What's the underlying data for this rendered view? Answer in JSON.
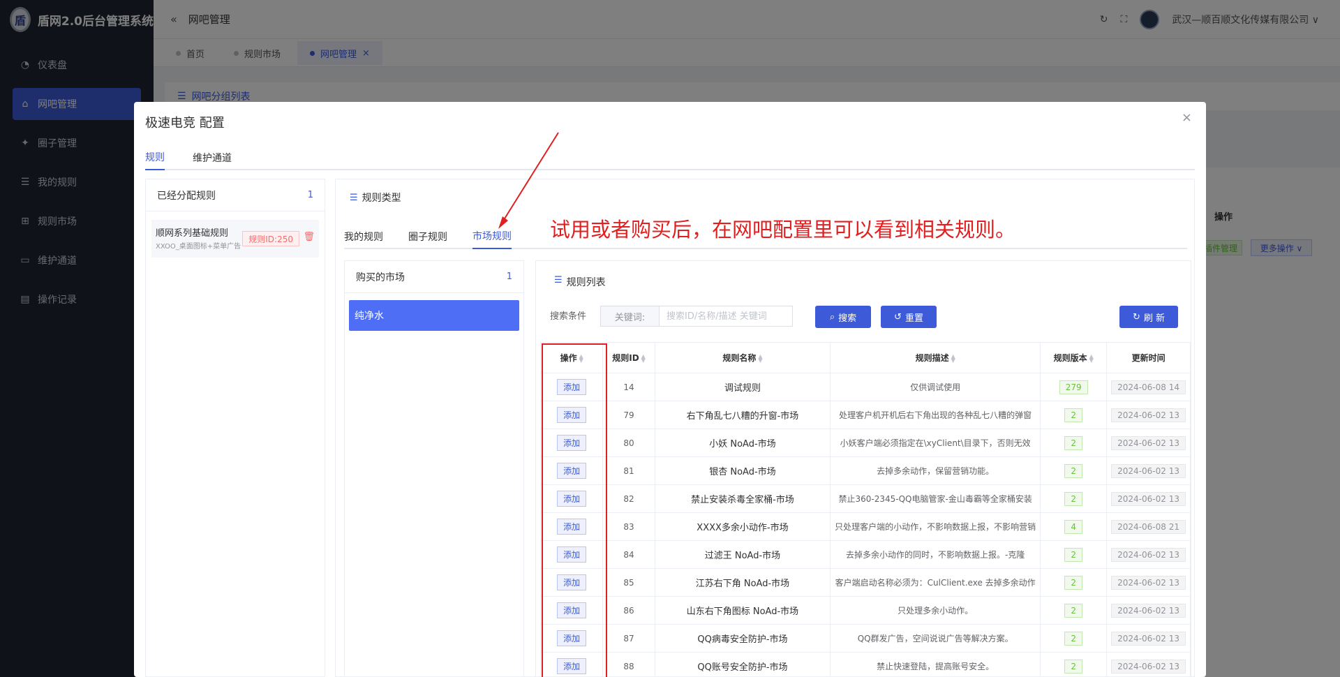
{
  "app": {
    "title": "盾网2.0后台管理系统",
    "logo_text": "盾"
  },
  "sidebar": {
    "items": [
      {
        "label": "仪表盘",
        "icon": "dashboard-icon"
      },
      {
        "label": "网吧管理",
        "icon": "home-icon"
      },
      {
        "label": "圈子管理",
        "icon": "circle-icon"
      },
      {
        "label": "我的规则",
        "icon": "list-icon"
      },
      {
        "label": "规则市场",
        "icon": "gift-icon"
      },
      {
        "label": "维护通道",
        "icon": "monitor-icon"
      },
      {
        "label": "操作记录",
        "icon": "document-icon"
      }
    ],
    "active_index": 1
  },
  "header": {
    "breadcrumb": "网吧管理",
    "user": "武汉—顺百顺文化传媒有限公司"
  },
  "tags": [
    {
      "label": "首页"
    },
    {
      "label": "规则市场"
    },
    {
      "label": "网吧管理",
      "close": "×"
    }
  ],
  "background": {
    "group_list": "网吧分组列表",
    "op_header": "操作",
    "op_btn1": "插件管理",
    "op_btn2": "更多操作 ∨"
  },
  "dialog": {
    "title": "极速电竞 配置",
    "close": "×",
    "tabs": [
      "规则",
      "维护通道"
    ],
    "assigned": {
      "title": "已经分配规则",
      "count": "1",
      "rule": {
        "name": "顺网系列基础规则",
        "sub": "XXOO_桌面图标+菜单广告",
        "tag": "规则ID:250"
      }
    },
    "rule_type": "规则类型",
    "sub_tabs": [
      "我的规则",
      "圈子规则",
      "市场规则"
    ],
    "annotation": "试用或者购买后，在网吧配置里可以看到相关规则。",
    "market": {
      "title": "购买的市场",
      "count": "1",
      "item": "纯净水"
    },
    "list": {
      "title": "规则列表",
      "search_label": "搜索条件",
      "search_prefix": "关键词:",
      "search_placeholder": "搜索ID/名称/描述 关键词",
      "search_btn": "搜索",
      "reset_btn": "重置",
      "refresh_btn": "刷 新",
      "columns": [
        "操作",
        "规则ID",
        "规则名称",
        "规则描述",
        "规则版本",
        "更新时间"
      ],
      "add_label": "添加",
      "rows": [
        {
          "id": "14",
          "name": "调试规则",
          "desc": "仅供调试使用",
          "ver": "279",
          "time": "2024-06-08 14"
        },
        {
          "id": "79",
          "name": "右下角乱七八糟的升窗-市场",
          "desc": "处理客户机开机后右下角出现的各种乱七八糟的弹窗",
          "ver": "2",
          "time": "2024-06-02 13"
        },
        {
          "id": "80",
          "name": "小妖 NoAd-市场",
          "desc": "小妖客户端必须指定在\\xyClient\\目录下，否则无效",
          "ver": "2",
          "time": "2024-06-02 13"
        },
        {
          "id": "81",
          "name": "银杏 NoAd-市场",
          "desc": "去掉多余动作，保留营销功能。",
          "ver": "2",
          "time": "2024-06-02 13"
        },
        {
          "id": "82",
          "name": "禁止安装杀毒全家桶-市场",
          "desc": "禁止360-2345-QQ电脑管家-金山毒霸等全家桶安装",
          "ver": "2",
          "time": "2024-06-02 13"
        },
        {
          "id": "83",
          "name": "XXXX多余小动作-市场",
          "desc": "只处理客户端的小动作，不影响数据上报，不影响营销",
          "ver": "4",
          "time": "2024-06-08 21"
        },
        {
          "id": "84",
          "name": "过滤王 NoAd-市场",
          "desc": "去掉多余小动作的同时，不影响数据上报。-克隆",
          "ver": "2",
          "time": "2024-06-02 13"
        },
        {
          "id": "85",
          "name": "江苏右下角 NoAd-市场",
          "desc": "客户端启动名称必须为：CulClient.exe 去掉多余动作",
          "ver": "2",
          "time": "2024-06-02 13"
        },
        {
          "id": "86",
          "name": "山东右下角图标 NoAd-市场",
          "desc": "只处理多余小动作。",
          "ver": "2",
          "time": "2024-06-02 13"
        },
        {
          "id": "87",
          "name": "QQ病毒安全防护-市场",
          "desc": "QQ群发广告，空间说说广告等解决方案。",
          "ver": "2",
          "time": "2024-06-02 13"
        },
        {
          "id": "88",
          "name": "QQ账号安全防护-市场",
          "desc": "禁止快速登陆，提高账号安全。",
          "ver": "2",
          "time": "2024-06-02 13"
        }
      ]
    }
  },
  "colors": {
    "primary": "#3d5ad8",
    "annotation": "#e02020",
    "sidebar_bg": "#1f2430"
  }
}
